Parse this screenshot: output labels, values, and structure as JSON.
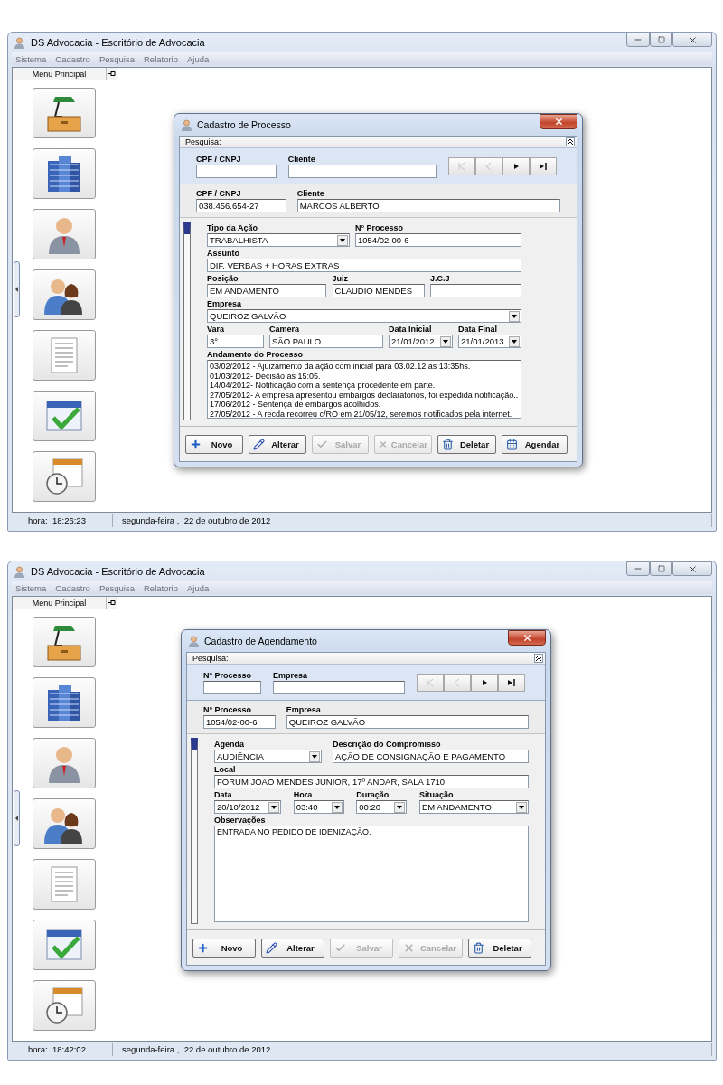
{
  "screens": [
    {
      "window": {
        "title": "DS Advocacia - Escritório de Advocacia"
      },
      "menu": [
        "Sistema",
        "Cadastro",
        "Pesquisa",
        "Relatorio",
        "Ajuda"
      ],
      "sidebar": {
        "title": "Menu Principal"
      },
      "dialog": {
        "title": "Cadastro de Processo",
        "search": {
          "label": "Pesquisa:",
          "fields": [
            {
              "label": "CPF / CNPJ"
            },
            {
              "label": "Cliente"
            }
          ],
          "nav": [
            {
              "kind": "first",
              "disabled": true
            },
            {
              "kind": "prev",
              "disabled": true
            },
            {
              "kind": "next",
              "disabled": false
            },
            {
              "kind": "last",
              "disabled": false
            }
          ]
        },
        "record": [
          {
            "label": "CPF / CNPJ",
            "value": "038.456.654-27"
          },
          {
            "label": "Cliente",
            "value": "MARCOS ALBERTO"
          }
        ],
        "form": [
          [
            {
              "kind": "select",
              "label": "Tipo da Ação",
              "value": "TRABALHISTA"
            },
            {
              "kind": "text",
              "label": "N° Processo",
              "value": "1054/02-00-6"
            }
          ],
          [
            {
              "kind": "text",
              "label": "Assunto",
              "value": "DIF. VERBAS + HORAS EXTRAS"
            }
          ],
          [
            {
              "kind": "text",
              "label": "Posição",
              "value": "EM ANDAMENTO"
            },
            {
              "kind": "text",
              "label": "Juiz",
              "value": "CLAUDIO MENDES"
            },
            {
              "kind": "text",
              "label": "J.C.J"
            }
          ],
          [
            {
              "kind": "select",
              "label": "Empresa",
              "value": "QUEIROZ GALVÃO"
            }
          ],
          [
            {
              "kind": "text",
              "label": "Vara",
              "value": "3°"
            },
            {
              "kind": "text",
              "label": "Camera",
              "value": "SÃO PAULO"
            },
            {
              "kind": "select",
              "label": "Data Inicial",
              "value": "21/01/2012"
            },
            {
              "kind": "select",
              "label": "Data Final",
              "value": "21/01/2013"
            }
          ],
          [
            {
              "kind": "memo",
              "label": "Andamento do Processo",
              "lines": [
                "03/02/2012 - Ajuizamento da ação com inicial para 03.02.12 as 13:35hs.",
                "01/03/2012- Decisão as 15:05.",
                "14/04/2012- Notificação com a sentença procedente em parte.",
                "27/05/2012- A empresa apresentou embargos declaratorios, foi expedida notificação..",
                "17/06/2012 - Sentença de embargos acolhidos.",
                "27/05/2012 - A recda recorreu c/RO em 21/05/12, seremos notificados pela internet."
              ]
            }
          ]
        ],
        "buttons": [
          {
            "kind": "new",
            "label": "Novo",
            "disabled": false
          },
          {
            "kind": "edit",
            "label": "Alterar",
            "disabled": false
          },
          {
            "kind": "save",
            "label": "Salvar",
            "disabled": true
          },
          {
            "kind": "cancel",
            "label": "Cancelar",
            "disabled": true
          },
          {
            "kind": "delete",
            "label": "Deletar",
            "disabled": false
          },
          {
            "kind": "schedule",
            "label": "Agendar",
            "disabled": false
          }
        ]
      },
      "status": {
        "time": "hora:  18:26:23",
        "date": "segunda-feira ,  22 de outubro de 2012"
      }
    },
    {
      "window": {
        "title": "DS Advocacia - Escritório de Advocacia"
      },
      "menu": [
        "Sistema",
        "Cadastro",
        "Pesquisa",
        "Relatorio",
        "Ajuda"
      ],
      "sidebar": {
        "title": "Menu Principal"
      },
      "dialog": {
        "title": "Cadastro de Agendamento",
        "search": {
          "label": "Pesquisa:",
          "fields": [
            {
              "label": "N° Processo"
            },
            {
              "label": "Empresa"
            }
          ],
          "nav": [
            {
              "kind": "first",
              "disabled": true
            },
            {
              "kind": "prev",
              "disabled": true
            },
            {
              "kind": "next",
              "disabled": false
            },
            {
              "kind": "last",
              "disabled": false
            }
          ]
        },
        "record": [
          {
            "label": "N° Processo",
            "value": "1054/02-00-6"
          },
          {
            "label": "Empresa",
            "value": "QUEIROZ GALVÃO"
          }
        ],
        "form": [
          [
            {
              "kind": "select",
              "label": "Agenda",
              "value": "AUDIÊNCIA"
            },
            {
              "kind": "text",
              "label": "Descrição do Compromisso",
              "value": "AÇÃO DE CONSIGNAÇÃO E PAGAMENTO"
            }
          ],
          [
            {
              "kind": "text",
              "label": "Local",
              "value": "FORUM JOÃO MENDES JÚNIOR, 17º ANDAR, SALA 1710"
            }
          ],
          [
            {
              "kind": "select",
              "label": "Data",
              "value": "20/10/2012"
            },
            {
              "kind": "select",
              "label": "Hora",
              "value": "03:40"
            },
            {
              "kind": "select",
              "label": "Duração",
              "value": "00:20"
            },
            {
              "kind": "select",
              "label": "Situação",
              "value": "EM ANDAMENTO"
            }
          ],
          [
            {
              "kind": "memo",
              "label": "Observações",
              "lines": [
                "ENTRADA NO PEDIDO DE IDENIZAÇÃO."
              ]
            }
          ]
        ],
        "buttons": [
          {
            "kind": "new",
            "label": "Novo",
            "disabled": false
          },
          {
            "kind": "edit",
            "label": "Alterar",
            "disabled": false
          },
          {
            "kind": "save",
            "label": "Salvar",
            "disabled": true
          },
          {
            "kind": "cancel",
            "label": "Cancelar",
            "disabled": true
          },
          {
            "kind": "delete",
            "label": "Deletar",
            "disabled": false
          }
        ]
      },
      "status": {
        "time": "hora:  18:42:02",
        "date": "segunda-feira ,  22 de outubro de 2012"
      }
    }
  ]
}
